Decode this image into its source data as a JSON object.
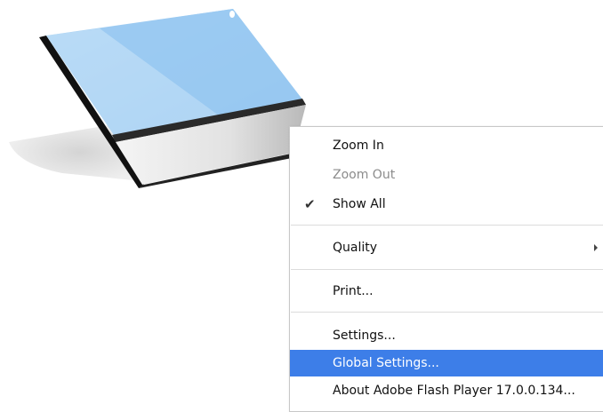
{
  "context_menu": {
    "items": [
      {
        "label": "Zoom In",
        "state": "enabled"
      },
      {
        "label": "Zoom Out",
        "state": "disabled"
      },
      {
        "label": "Show All",
        "state": "checked"
      },
      {
        "label": "Quality",
        "state": "submenu"
      },
      {
        "label": "Print...",
        "state": "enabled"
      },
      {
        "label": "Settings...",
        "state": "enabled"
      },
      {
        "label": "Global Settings...",
        "state": "highlighted"
      },
      {
        "label": "About Adobe Flash Player 17.0.0.134...",
        "state": "enabled"
      }
    ],
    "check_glyph": "✔",
    "highlight_color": "#3d7ee8"
  }
}
